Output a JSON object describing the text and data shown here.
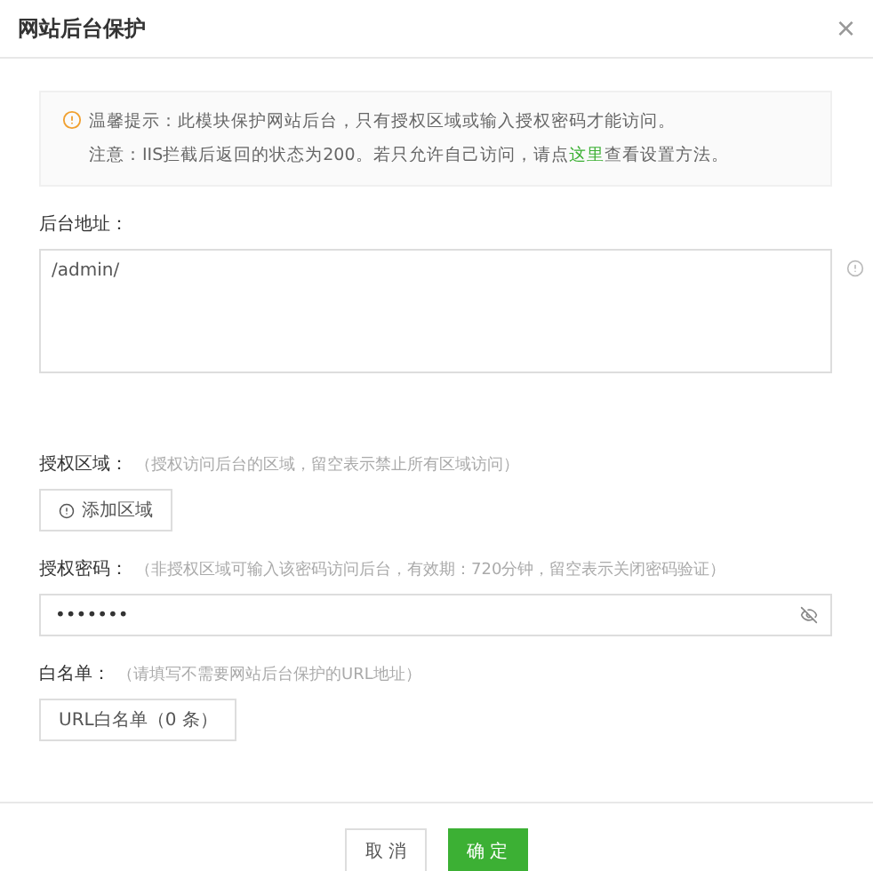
{
  "dialog": {
    "title": "网站后台保护",
    "close": "×"
  },
  "notice": {
    "lines": [
      "温馨提示：此模块保护网站后台，只有授权区域或输入授权密码才能访问。"
    ],
    "note_before": "注意：IIS拦截后返回的状态为200。若只允许自己访问，请点",
    "link": "这里",
    "note_after": "查看设置方法。"
  },
  "admin_path": {
    "label": "后台地址：",
    "value": "/admin/"
  },
  "regions": {
    "label": "授权区域：",
    "hint": "（授权访问后台的区域，留空表示禁止所有区域访问）",
    "button": "添加区域"
  },
  "password": {
    "label": "授权密码：",
    "hint": "（非授权区域可输入该密码访问后台，有效期：720分钟，留空表示关闭密码验证）",
    "value": "•••••••"
  },
  "whitelist": {
    "label": "白名单：",
    "hint": "（请填写不需要网站后台保护的URL地址）",
    "button": "URL白名单（0 条）"
  },
  "buttons": [
    {
      "label": "取 消",
      "kind": "secondary"
    },
    {
      "label": "确 定",
      "kind": "primary"
    }
  ]
}
